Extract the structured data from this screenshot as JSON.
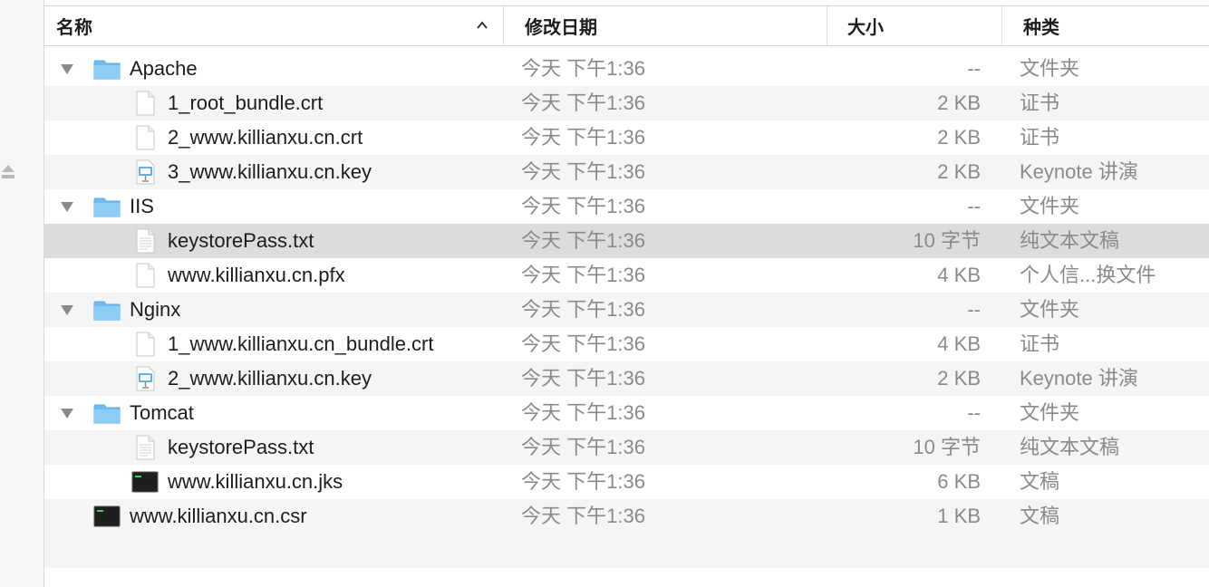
{
  "columns": {
    "name": "名称",
    "date": "修改日期",
    "size": "大小",
    "kind": "种类"
  },
  "rows": [
    {
      "name": "Apache",
      "date": "今天 下午1:36",
      "size": "--",
      "kind": "文件夹",
      "icon": "folder-icon",
      "level": 0,
      "disclosure": true
    },
    {
      "name": "1_root_bundle.crt",
      "date": "今天 下午1:36",
      "size": "2 KB",
      "kind": "证书",
      "icon": "document-icon",
      "level": 1
    },
    {
      "name": "2_www.killianxu.cn.crt",
      "date": "今天 下午1:36",
      "size": "2 KB",
      "kind": "证书",
      "icon": "document-icon",
      "level": 1
    },
    {
      "name": "3_www.killianxu.cn.key",
      "date": "今天 下午1:36",
      "size": "2 KB",
      "kind": "Keynote 讲演",
      "icon": "keynote-icon",
      "level": 1
    },
    {
      "name": "IIS",
      "date": "今天 下午1:36",
      "size": "--",
      "kind": "文件夹",
      "icon": "folder-icon",
      "level": 0,
      "disclosure": true
    },
    {
      "name": "keystorePass.txt",
      "date": "今天 下午1:36",
      "size": "10 字节",
      "kind": "纯文本文稿",
      "icon": "text-document-icon",
      "level": 1,
      "selected": true
    },
    {
      "name": "www.killianxu.cn.pfx",
      "date": "今天 下午1:36",
      "size": "4 KB",
      "kind": "个人信...换文件",
      "icon": "document-icon",
      "level": 1
    },
    {
      "name": "Nginx",
      "date": "今天 下午1:36",
      "size": "--",
      "kind": "文件夹",
      "icon": "folder-icon",
      "level": 0,
      "disclosure": true
    },
    {
      "name": "1_www.killianxu.cn_bundle.crt",
      "date": "今天 下午1:36",
      "size": "4 KB",
      "kind": "证书",
      "icon": "document-icon",
      "level": 1
    },
    {
      "name": "2_www.killianxu.cn.key",
      "date": "今天 下午1:36",
      "size": "2 KB",
      "kind": "Keynote 讲演",
      "icon": "keynote-icon",
      "level": 1
    },
    {
      "name": "Tomcat",
      "date": "今天 下午1:36",
      "size": "--",
      "kind": "文件夹",
      "icon": "folder-icon",
      "level": 0,
      "disclosure": true
    },
    {
      "name": "keystorePass.txt",
      "date": "今天 下午1:36",
      "size": "10 字节",
      "kind": "纯文本文稿",
      "icon": "text-document-icon",
      "level": 1
    },
    {
      "name": "www.killianxu.cn.jks",
      "date": "今天 下午1:36",
      "size": "6 KB",
      "kind": "文稿",
      "icon": "terminal-icon",
      "level": 1
    },
    {
      "name": "www.killianxu.cn.csr",
      "date": "今天 下午1:36",
      "size": "1 KB",
      "kind": "文稿",
      "icon": "terminal-icon",
      "level": 0
    }
  ],
  "colors": {
    "folder": "#6fbcf0",
    "stripe": "#f4f5f5",
    "selected": "#dcdcdc",
    "secondary_text": "#8a8a8a"
  }
}
